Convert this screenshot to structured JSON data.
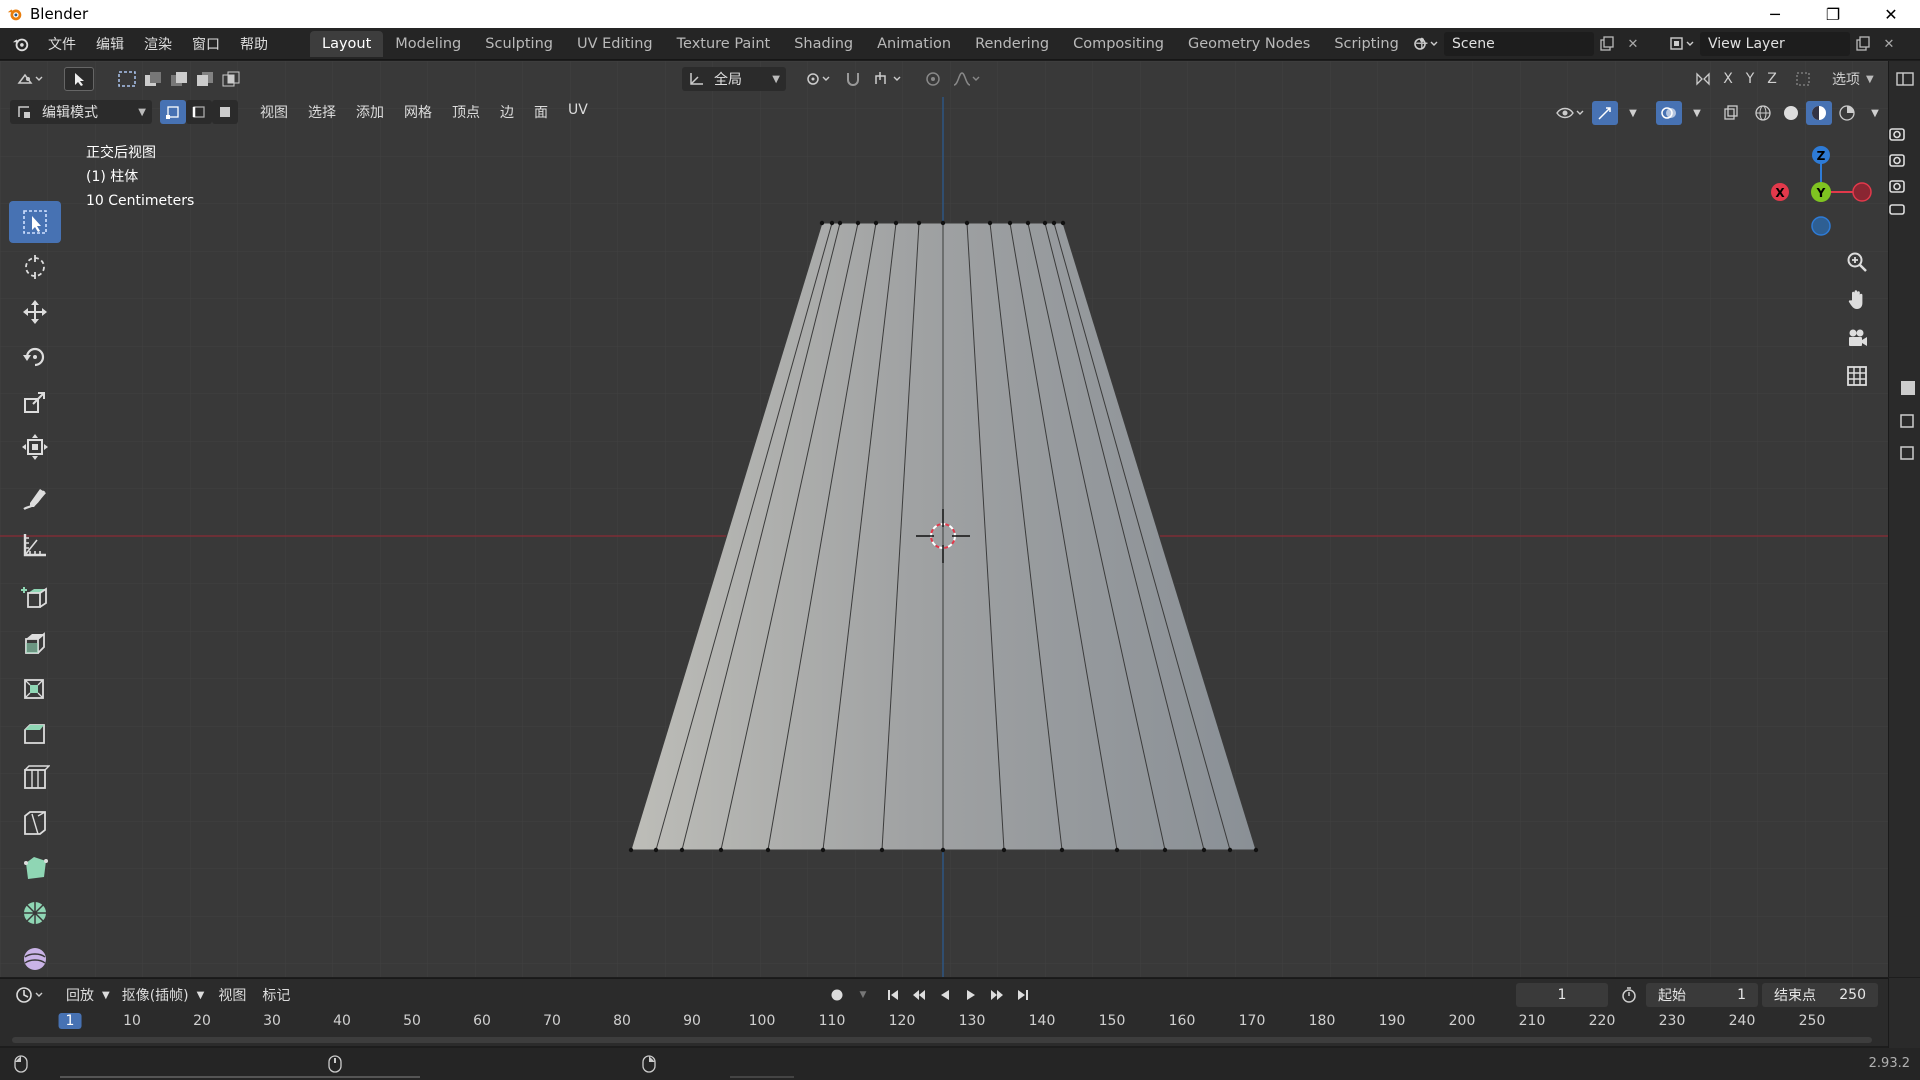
{
  "window": {
    "title": "Blender",
    "minimize": "─",
    "restore": "❐",
    "close": "✕"
  },
  "menu": [
    "文件",
    "编辑",
    "渲染",
    "窗口",
    "帮助"
  ],
  "tabs": [
    "Layout",
    "Modeling",
    "Sculpting",
    "UV Editing",
    "Texture Paint",
    "Shading",
    "Animation",
    "Rendering",
    "Compositing",
    "Geometry Nodes",
    "Scripting"
  ],
  "active_tab": "Layout",
  "scene": {
    "name": "Scene"
  },
  "view_layer": {
    "name": "View Layer"
  },
  "header": {
    "mode": "编辑模式",
    "menus": [
      "视图",
      "选择",
      "添加",
      "网格",
      "顶点",
      "边",
      "面",
      "UV"
    ],
    "orientation": "全局",
    "options": "选项",
    "axes": [
      "X",
      "Y",
      "Z"
    ]
  },
  "viewport_info": {
    "view_name": "正交后视图",
    "object": "(1) 柱体",
    "scale": "10 Centimeters"
  },
  "gizmo": {
    "z": "Z",
    "y": "Y",
    "x": "X"
  },
  "timeline": {
    "menus": [
      "回放",
      "抠像(插帧)",
      "视图",
      "标记"
    ],
    "current_frame": "1",
    "start_label": "起始",
    "start": "1",
    "end_label": "结束点",
    "end": "250",
    "ruler": [
      "1",
      "10",
      "20",
      "30",
      "40",
      "50",
      "60",
      "70",
      "80",
      "90",
      "100",
      "110",
      "120",
      "130",
      "140",
      "150",
      "160",
      "170",
      "180",
      "190",
      "200",
      "210",
      "220",
      "230",
      "240",
      "250"
    ]
  },
  "status": {
    "version": "2.93.2"
  },
  "colors": {
    "accent": "#4772b3",
    "x_axis": "#e2394b",
    "y_axis": "#7fc421",
    "z_axis": "#2e7bd6"
  }
}
